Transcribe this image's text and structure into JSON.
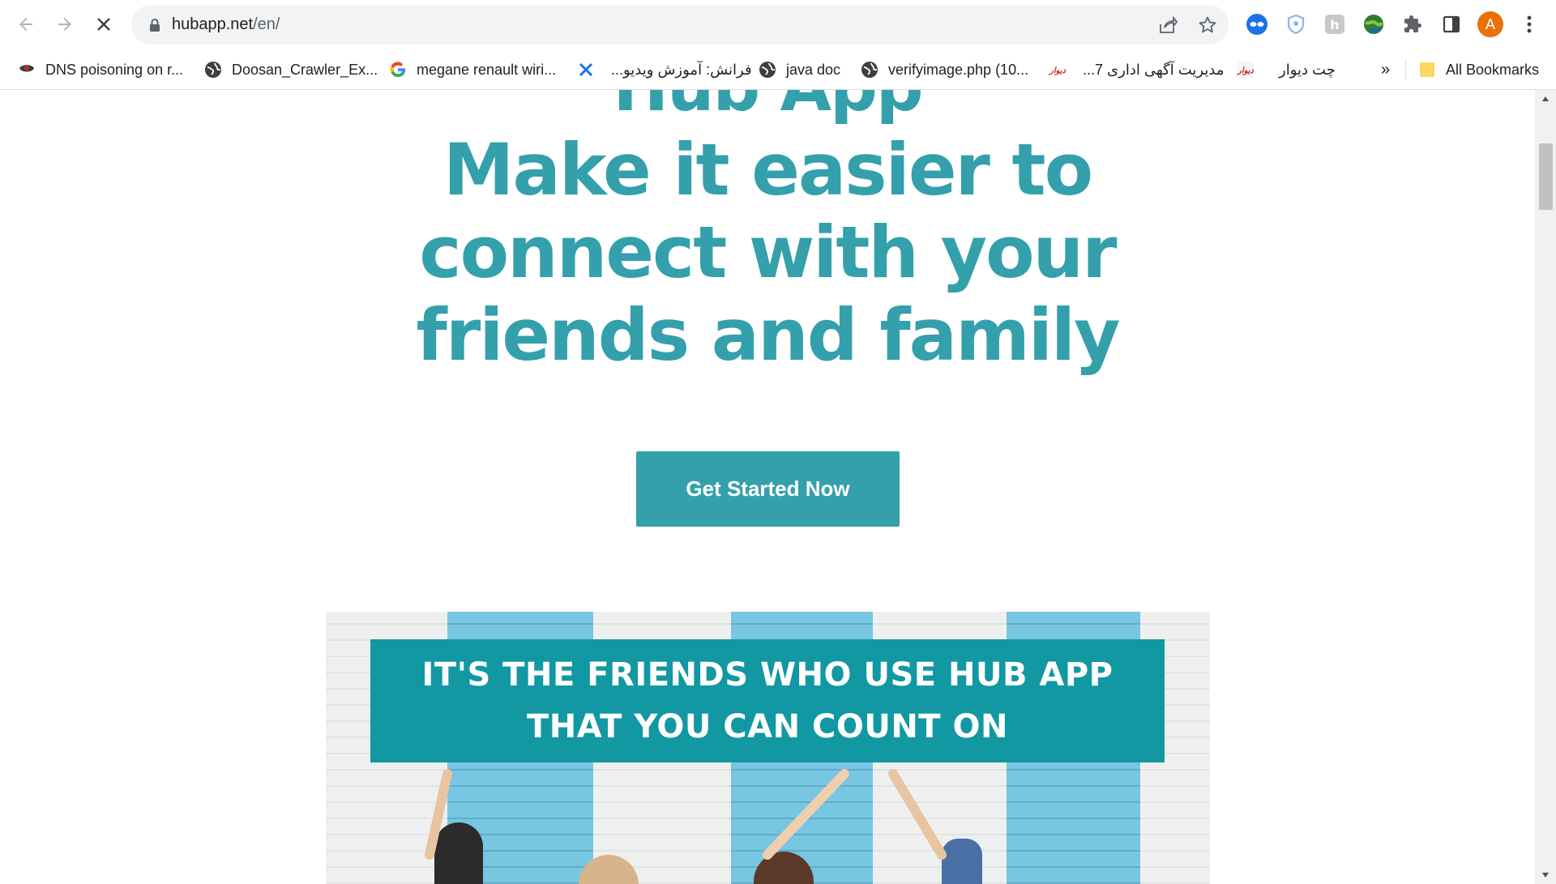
{
  "browser": {
    "url_host": "hubapp.net",
    "url_path": "/en/",
    "bookmarks": [
      {
        "label": "DNS poisoning on r...",
        "icon": "dns-favicon-icon"
      },
      {
        "label": "Doosan_Crawler_Ex...",
        "icon": "globe-icon"
      },
      {
        "label": "megane renault wiri...",
        "icon": "google-icon"
      },
      {
        "label": "فرانش: آموزش ویدیو...",
        "icon": "x-favicon-icon"
      },
      {
        "label": "java doc",
        "icon": "globe-icon"
      },
      {
        "label": "verifyimage.php (10...",
        "icon": "globe-icon"
      },
      {
        "label": "مدیریت آگهی اداری 7...",
        "icon": "divar-favicon-icon"
      },
      {
        "label": "چت دیوار",
        "icon": "divar-favicon-icon"
      }
    ],
    "more_bookmarks": "»",
    "all_bookmarks_label": "All Bookmarks",
    "profile_initial": "A",
    "colors": {
      "profile": "#e8710a"
    }
  },
  "page": {
    "title_partial": "Hub App",
    "headline_lines": [
      "Make it easier to",
      "connect with your",
      "friends and family"
    ],
    "cta_label": "Get Started Now",
    "banner_lines": [
      "IT'S THE FRIENDS WHO USE HUB APP",
      "THAT YOU CAN COUNT ON"
    ],
    "colors": {
      "brand": "#34a0ab",
      "banner_box": "#1198a3"
    }
  }
}
